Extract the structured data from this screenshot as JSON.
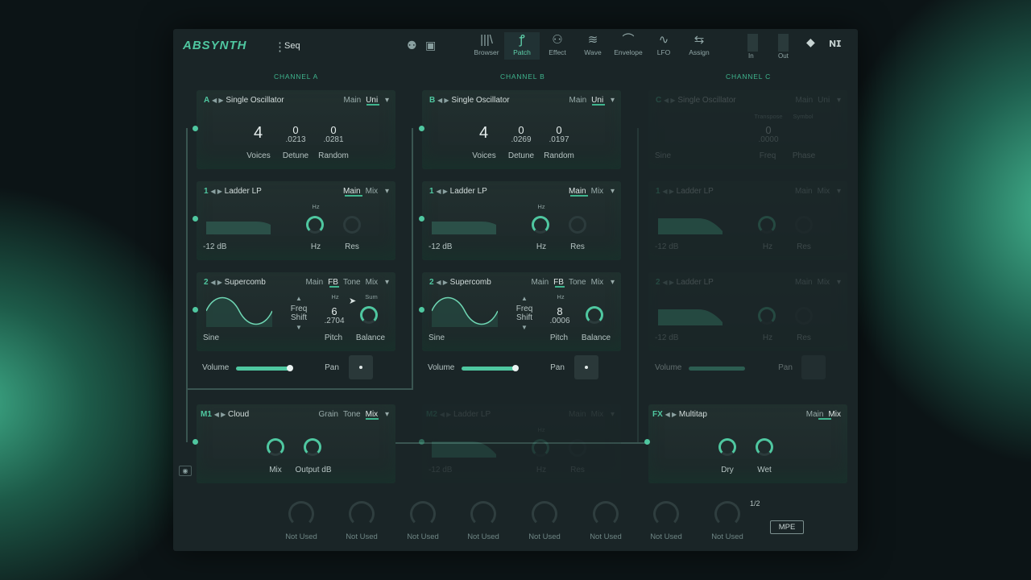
{
  "header": {
    "logo": "ABSYNTH",
    "menu_glyph": "⋮",
    "mode": "Seq",
    "nav": [
      {
        "label": "Browser",
        "icon": "|||\\"
      },
      {
        "label": "Patch",
        "icon": "ꝭ"
      },
      {
        "label": "Effect",
        "icon": "⚇"
      },
      {
        "label": "Wave",
        "icon": "≋"
      },
      {
        "label": "Envelope",
        "icon": "⌒"
      },
      {
        "label": "LFO",
        "icon": "∿"
      },
      {
        "label": "Assign",
        "icon": "⇆"
      }
    ],
    "in_label": "In",
    "out_label": "Out"
  },
  "channels": {
    "a": "CHANNEL A",
    "b": "CHANNEL B",
    "c": "CHANNEL C"
  },
  "chA": {
    "osc": {
      "letter": "A",
      "name": "Single Oscillator",
      "tab_main": "Main",
      "tab_uni": "Uni",
      "voices": "4",
      "detune": "0",
      "detune_sub": ".0213",
      "random": "0",
      "random_sub": ".0281",
      "voices_l": "Voices",
      "detune_l": "Detune",
      "random_l": "Random"
    },
    "f1": {
      "num": "1",
      "name": "Ladder LP",
      "tab_main": "Main",
      "tab_mix": "Mix",
      "db": "-12 dB",
      "hz_top": "Hz",
      "hz": "Hz",
      "res": "Res"
    },
    "f2": {
      "num": "2",
      "name": "Supercomb",
      "t1": "Main",
      "t2": "FB",
      "t3": "Tone",
      "t4": "Mix",
      "wave": "Sine",
      "freq_shift": "Freq\nShift",
      "hz_top": "Hz",
      "pitch_val": "6",
      "pitch_sub": ".2704",
      "pitch": "Pitch",
      "sum": "Sum",
      "balance": "Balance"
    },
    "volume": "Volume",
    "pan": "Pan"
  },
  "chB": {
    "osc": {
      "letter": "B",
      "name": "Single Oscillator",
      "tab_main": "Main",
      "tab_uni": "Uni",
      "voices": "4",
      "detune": "0",
      "detune_sub": ".0269",
      "random": "0",
      "random_sub": ".0197",
      "voices_l": "Voices",
      "detune_l": "Detune",
      "random_l": "Random"
    },
    "f1": {
      "num": "1",
      "name": "Ladder LP",
      "tab_main": "Main",
      "tab_mix": "Mix",
      "db": "-12 dB",
      "hz_top": "Hz",
      "hz": "Hz",
      "res": "Res"
    },
    "f2": {
      "num": "2",
      "name": "Supercomb",
      "t1": "Main",
      "t2": "FB",
      "t3": "Tone",
      "t4": "Mix",
      "wave": "Sine",
      "freq_shift": "Freq\nShift",
      "hz_top": "Hz",
      "pitch_val": "8",
      "pitch_sub": ".0006",
      "pitch": "Pitch",
      "sum": "Sum",
      "balance": "Balance"
    },
    "volume": "Volume",
    "pan": "Pan"
  },
  "chC": {
    "osc": {
      "letter": "C",
      "name": "Single Oscillator",
      "tab_main": "Main",
      "tab_uni": "Uni",
      "transpose": "Transpose",
      "symbol": "Symbol",
      "freq_val": "0",
      "freq_sub": ".0000",
      "wave": "Sine",
      "freq": "Freq",
      "phase": "Phase"
    },
    "f1": {
      "num": "1",
      "name": "Ladder LP",
      "tab_main": "Main",
      "tab_mix": "Mix",
      "db": "-12 dB",
      "hz": "Hz",
      "res": "Res"
    },
    "f2": {
      "num": "2",
      "name": "Ladder LP",
      "tab_main": "Main",
      "tab_mix": "Mix",
      "db": "-12 dB",
      "hz": "Hz",
      "res": "Res"
    },
    "volume": "Volume",
    "pan": "Pan"
  },
  "m1": {
    "label": "M1",
    "name": "Cloud",
    "t1": "Grain",
    "t2": "Tone",
    "t3": "Mix",
    "mix": "Mix",
    "output": "Output dB"
  },
  "m2": {
    "label": "M2",
    "name": "Ladder LP",
    "t1": "Main",
    "t2": "Mix",
    "db": "-12 dB",
    "hz_top": "Hz",
    "hz": "Hz",
    "res": "Res"
  },
  "fx": {
    "label": "FX",
    "name": "Multitap",
    "t1": "Main",
    "t2": "Mix",
    "dry": "Dry",
    "wet": "Wet"
  },
  "macros": {
    "labels": [
      "Not Used",
      "Not Used",
      "Not Used",
      "Not Used",
      "Not Used",
      "Not Used",
      "Not Used",
      "Not Used"
    ],
    "page": "1/2",
    "mpe": "MPE"
  }
}
